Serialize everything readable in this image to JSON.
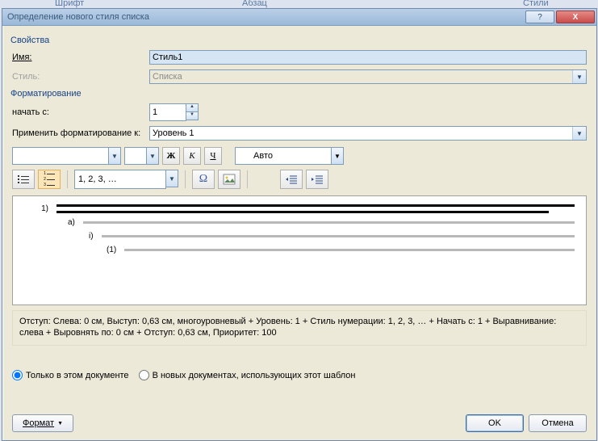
{
  "ribbon": {
    "font": "Шрифт",
    "paragraph": "Абзац",
    "styles": "Стили"
  },
  "dialog": {
    "title": "Определение нового стиля списка",
    "props_caption": "Свойства",
    "name_label": "Имя:",
    "name_value": "Стиль1",
    "style_label": "Стиль:",
    "style_value": "Списка",
    "format_caption": "Форматирование",
    "startat_label": "начать с:",
    "startat_value": "1",
    "applyto_label": "Применить форматирование к:",
    "applyto_value": "Уровень 1",
    "bold": "Ж",
    "italic": "К",
    "underline": "Ч",
    "auto_label": "Авто",
    "numfmt_value": "1, 2, 3, …",
    "symbol_icon": "Ω",
    "preview": {
      "l1": "1)",
      "l2": "a)",
      "l3": "i)",
      "l4": "(1)"
    },
    "description": "Отступ: Слева:  0 см, Выступ:  0,63 см, многоуровневый + Уровень: 1 + Стиль нумерации: 1, 2, 3, … + Начать с: 1 + Выравнивание: слева + Выровнять по:  0 см + Отступ:  0,63 см, Приоритет: 100",
    "radio_this": "Только в этом документе",
    "radio_new": "В новых документах, использующих этот шаблон",
    "format_btn": "Формат",
    "ok": "OK",
    "cancel": "Отмена"
  }
}
